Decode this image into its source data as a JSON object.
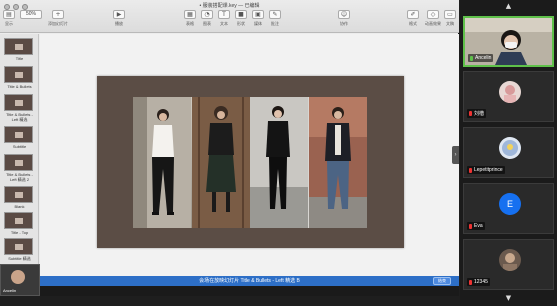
{
  "window": {
    "title": "• 服装搭配课.key — 已编辑",
    "zoom": "50%"
  },
  "toolbar": {
    "items": [
      {
        "label": "显示",
        "icon": "view-icon"
      },
      {
        "label": "缩放",
        "icon": "zoom-icon"
      },
      {
        "label": "添加幻灯片",
        "icon": "add-slide-icon"
      },
      {
        "label": "播放",
        "icon": "play-icon"
      },
      {
        "label": "表格",
        "icon": "table-icon"
      },
      {
        "label": "图表",
        "icon": "chart-icon"
      },
      {
        "label": "文本",
        "icon": "text-icon"
      },
      {
        "label": "形状",
        "icon": "shape-icon"
      },
      {
        "label": "媒体",
        "icon": "media-icon"
      },
      {
        "label": "批注",
        "icon": "comment-icon"
      },
      {
        "label": "协作",
        "icon": "collaborate-icon"
      },
      {
        "label": "格式",
        "icon": "format-icon"
      },
      {
        "label": "动画效果",
        "icon": "animate-icon"
      },
      {
        "label": "文稿",
        "icon": "document-icon"
      }
    ]
  },
  "navigator": {
    "slides": [
      {
        "label": "Title"
      },
      {
        "label": "Title & Bullets"
      },
      {
        "label": "Title & Bullets - Left 精选"
      },
      {
        "label": "Subtitle"
      },
      {
        "label": "Title & Bullets - Left 精选 2"
      },
      {
        "label": "Blank"
      },
      {
        "label": "Title - Top"
      },
      {
        "label": "Subtitle 精选"
      }
    ],
    "add_label": "+"
  },
  "share_bar": {
    "text": "会场在放映幻灯片  Title & Bullets - Left 精选 B",
    "button": "结束"
  },
  "host_tile": {
    "name": "Ancelin"
  },
  "participants": [
    {
      "name": "Ancelin",
      "active": true,
      "type": "video"
    },
    {
      "name": "刘楷",
      "active": false,
      "type": "avatar"
    },
    {
      "name": "Lepetitprince",
      "active": false,
      "type": "avatar"
    },
    {
      "name": "Eva",
      "active": false,
      "type": "initial",
      "initial": "E"
    },
    {
      "name": "12345",
      "active": false,
      "type": "avatar"
    }
  ],
  "colors": {
    "slide_bg": "#5b4d45",
    "share_bar": "#2d6fc7",
    "active_speaker": "#5fc14a",
    "initial_avatar": "#1670f0"
  }
}
